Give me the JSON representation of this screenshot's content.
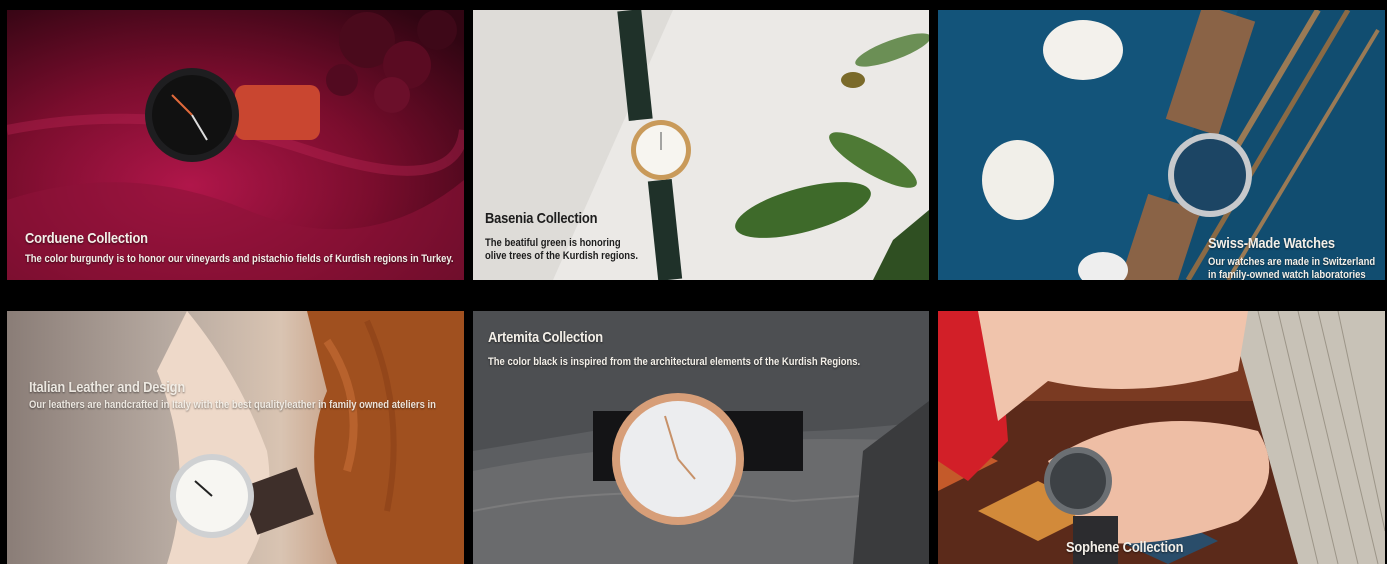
{
  "tiles": [
    {
      "title": "Corduene Collection",
      "description": "The color burgundy is to honor our vineyards and pistachio fields of Kurdish regions in Turkey."
    },
    {
      "title": "Basenia Collection",
      "description_line1": "The beatiful green is honoring",
      "description_line2": "olive trees of the Kurdish regions."
    },
    {
      "title": "Swiss-Made Watches",
      "description_line1": "Our watches are made in Switzerland",
      "description_line2": "in family-owned watch laboratories"
    },
    {
      "title": "Italian Leather and Design",
      "description": "Our leathers are handcrafted in Italy with the best qualityleather in family owned ateliers in"
    },
    {
      "title": "Artemita Collection",
      "description": "The color black is inspired from the architectural elements of the Kurdish Regions."
    },
    {
      "title": "Sophene Collection"
    }
  ],
  "colors": {
    "burgundy": "#7d0f2c",
    "teal": "#14506e",
    "stone": "#55575a",
    "text": "#f3efe8"
  }
}
